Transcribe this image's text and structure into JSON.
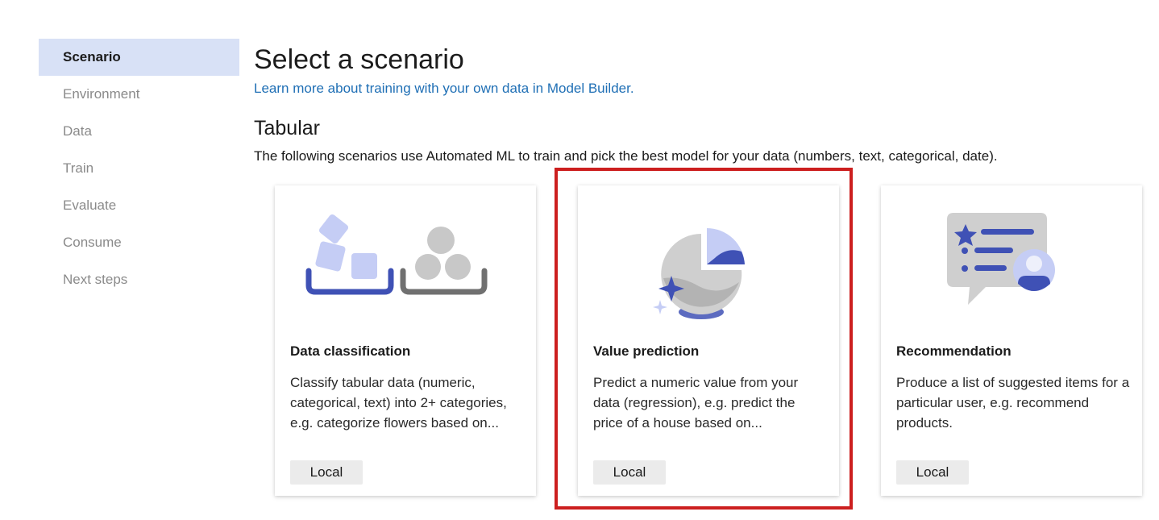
{
  "sidebar": {
    "items": [
      {
        "label": "Scenario"
      },
      {
        "label": "Environment"
      },
      {
        "label": "Data"
      },
      {
        "label": "Train"
      },
      {
        "label": "Evaluate"
      },
      {
        "label": "Consume"
      },
      {
        "label": "Next steps"
      }
    ]
  },
  "main": {
    "title": "Select a scenario",
    "learn_link": "Learn more about training with your own data in Model Builder.",
    "section": {
      "title": "Tabular",
      "description": "The following scenarios use Automated ML to train and pick the best model for your data (numbers, text, categorical, date)."
    },
    "cards": [
      {
        "title": "Data classification",
        "description": "Classify tabular data (numeric, categorical, text) into 2+ categories, e.g. categorize flowers based on...",
        "badge": "Local",
        "icon": "data-classification-icon"
      },
      {
        "title": "Value prediction",
        "description": "Predict a numeric value from your data (regression), e.g. predict the price of a house based on...",
        "badge": "Local",
        "icon": "value-prediction-icon"
      },
      {
        "title": "Recommendation",
        "description": "Produce a list of suggested items for a particular user, e.g. recommend products.",
        "badge": "Local",
        "icon": "recommendation-icon"
      }
    ]
  },
  "colors": {
    "accent_blue": "#3f51b5",
    "light_blue": "#c5cdf5",
    "link": "#1f6fb5",
    "nav_active_bg": "#d8e1f6",
    "highlight": "#cc1f1f"
  }
}
